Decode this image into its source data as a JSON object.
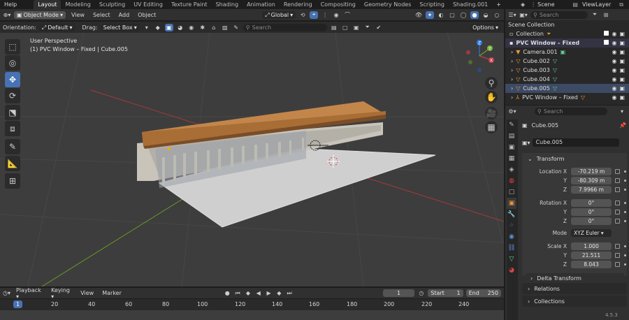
{
  "topbar": {
    "menu": "Help",
    "tabs": [
      "Layout",
      "Modeling",
      "Sculpting",
      "UV Editing",
      "Texture Paint",
      "Shading",
      "Animation",
      "Rendering",
      "Compositing",
      "Geometry Nodes",
      "Scripting",
      "Shading.001"
    ],
    "active_tab": "Layout",
    "plus": "+",
    "scene": "Scene",
    "view_layer": "ViewLayer"
  },
  "viewport_header": {
    "mode": "Object Mode",
    "menus": [
      "View",
      "Select",
      "Add",
      "Object"
    ],
    "transform": "Global"
  },
  "tool_header": {
    "orientation_label": "Orientation:",
    "orientation_value": "Default",
    "drag_label": "Drag:",
    "drag_value": "Select Box",
    "search_placeholder": "Search",
    "options": "Options"
  },
  "viewport": {
    "perspective": "User Perspective",
    "object_info": "(1) PVC Window – Fixed | Cube.005",
    "gizmo": {
      "x": "X",
      "y": "Y",
      "z": "Z"
    }
  },
  "outliner": {
    "search_placeholder": "Search",
    "items": [
      {
        "label": "Scene Collection",
        "indent": 0
      },
      {
        "label": "Collection",
        "indent": 1
      },
      {
        "label": "PVC Window – Fixed",
        "indent": 1
      },
      {
        "label": "Camera.001",
        "indent": 2
      },
      {
        "label": "Cube.002",
        "indent": 2
      },
      {
        "label": "Cube.003",
        "indent": 2
      },
      {
        "label": "Cube.004",
        "indent": 2
      },
      {
        "label": "Cube.005",
        "indent": 2
      },
      {
        "label": "PVC Window – Fixed",
        "indent": 2
      }
    ]
  },
  "properties": {
    "search_placeholder": "Search",
    "object_name": "Cube.005",
    "datablock": "Cube.005",
    "transform_title": "Transform",
    "location": {
      "label": "Location X",
      "x": "-70.219 m",
      "y": "-80.309 m",
      "z": "7.9966 m"
    },
    "rotation": {
      "label": "Rotation X",
      "x": "0°",
      "y": "0°",
      "z": "0°"
    },
    "mode": {
      "label": "Mode",
      "value": "XYZ Euler"
    },
    "scale": {
      "label": "Scale X",
      "x": "1.000",
      "y": "21.511",
      "z": "8.043"
    },
    "axis_y": "Y",
    "axis_z": "Z",
    "delta": "Delta Transform",
    "relations": "Relations",
    "collections": "Collections"
  },
  "timeline": {
    "menus": [
      "Playback",
      "Keying",
      "View",
      "Marker"
    ],
    "current_frame": "1",
    "start_label": "Start",
    "start": "1",
    "end_label": "End",
    "end": "250",
    "ticks": [
      "1",
      "20",
      "40",
      "60",
      "80",
      "100",
      "120",
      "140",
      "160",
      "180",
      "200",
      "220",
      "240"
    ],
    "version": "4.5.3"
  }
}
